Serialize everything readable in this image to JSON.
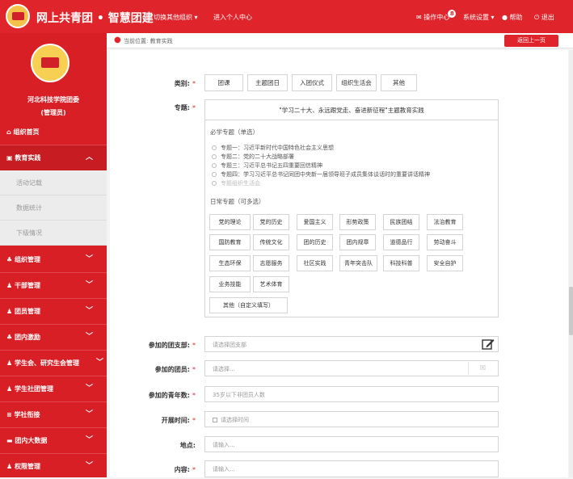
{
  "header": {
    "brand": "网上共青团 • 智慧团建",
    "switch_org": "切换其他组织 ▾",
    "personal_center": "进入个人中心",
    "notifications_label": "操作中心",
    "notifications_count": "8",
    "settings": "系统设置 ▾",
    "help": "帮助",
    "logout": "退出"
  },
  "sidebar": {
    "org_name": "河北科技学院团委",
    "role": "(管理员)",
    "items": [
      {
        "label": "组织首页",
        "icon": "home-icon"
      },
      {
        "label": "教育实践",
        "icon": "book-icon",
        "expanded": true
      },
      {
        "label": "组织管理",
        "icon": "org-icon"
      },
      {
        "label": "干部管理",
        "icon": "cadre-icon"
      },
      {
        "label": "团员管理",
        "icon": "member-icon"
      },
      {
        "label": "团内激励",
        "icon": "incentive-icon"
      },
      {
        "label": "学生会、研究生会管理",
        "icon": "student-union-icon"
      },
      {
        "label": "学生社团管理",
        "icon": "club-icon"
      },
      {
        "label": "学社衔接",
        "icon": "link-icon"
      },
      {
        "label": "团内大数据",
        "icon": "data-icon"
      },
      {
        "label": "权限管理",
        "icon": "lock-icon"
      }
    ],
    "sub_items": [
      "活动记载",
      "数据统计",
      "下级情况"
    ]
  },
  "breadcrumb": {
    "text": "当前位置: 教育实践",
    "back_label": "返回上一页"
  },
  "form": {
    "category_label": "类别:",
    "categories": [
      "团课",
      "主题团日",
      "入团仪式",
      "组织生活会",
      "其他"
    ],
    "topic_label": "专题:",
    "topic_header": "\"学习二十大、永远跟党走、奋进新征程\"主题教育实践",
    "required_section": "必学专题（单选）",
    "required_topics": [
      "专题一：习近平新时代中国特色社会主义思想",
      "专题二：党的二十大战略部署",
      "专题三：习近平总书记五四重要回信精神",
      "专题四：学习习近平总书记同团中央新一届领导班子成员集体谈话时的重要讲话精神",
      "专题组织生活会"
    ],
    "daily_section": "日常专题（可多选）",
    "daily_topics": [
      "党的理论",
      "党的历史",
      "爱国主义",
      "形势政策",
      "民族团结",
      "法治教育",
      "国防教育",
      "传统文化",
      "团的历史",
      "团内规章",
      "道德品行",
      "劳动奋斗",
      "生态环保",
      "志愿服务",
      "社区实践",
      "青年突击队",
      "科技科普",
      "安全自护",
      "业务技能",
      "艺术体育"
    ],
    "other_topic": "其他（自定义填写）",
    "branch_label": "参加的团支部:",
    "branch_placeholder": "请选择团支部",
    "members_label": "参加的团员:",
    "members_placeholder": "请选择...",
    "youth_label": "参加的青年数:",
    "youth_placeholder": "35岁以下非团员人数",
    "time_label": "开展时间:",
    "time_placeholder": "请选择时间",
    "location_label": "地点:",
    "location_placeholder": "请输入...",
    "content_label": "内容:",
    "content_placeholder": "请输入..."
  }
}
